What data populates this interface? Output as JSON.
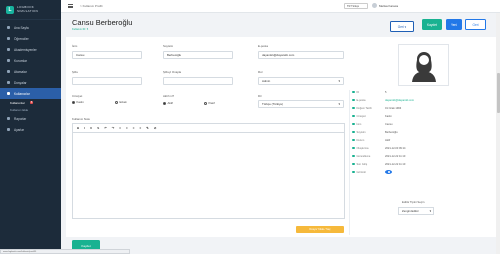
{
  "app": {
    "logo_title": "LOGBOOK",
    "logo_subtitle": "SIMULATION"
  },
  "sidebar": {
    "items": [
      {
        "label": "Ana Sayfa"
      },
      {
        "label": "Öğrenciler"
      },
      {
        "label": "Akademisyenler"
      },
      {
        "label": "Kurumlar"
      },
      {
        "label": "Atamalar"
      },
      {
        "label": "Dosyalar"
      },
      {
        "label": "Kullanıcılar"
      }
    ],
    "sub_items": [
      {
        "label": "Kullanıcılar",
        "badge": "5"
      },
      {
        "label": "Kullanıcı Ekle"
      }
    ],
    "items_after": [
      {
        "label": "Raporlar"
      },
      {
        "label": "Ayarlar"
      }
    ]
  },
  "topbar": {
    "breadcrumb": "> Kullanıcı Profili",
    "language": "TR Türkçe",
    "user_name": "Melisa Karaca"
  },
  "page": {
    "title": "Cansu Berberoğlu",
    "subtitle": "Kullanıcı ID: 5"
  },
  "buttons": {
    "geri": "Geri ▾",
    "kaydet": "Kaydet",
    "yeni": "Yeni",
    "geri2": "Geri",
    "upload": "Dosya Yükle / Seç",
    "save_bottom": "Kaydet"
  },
  "form": {
    "isim_label": "İsim",
    "isim_value": "Cansu",
    "soyisim_label": "Soyisim",
    "soyisim_value": "Berberoğlu",
    "eposta_label": "E-posta",
    "eposta_value": "dayanıklı@dayanıklı.com",
    "sifre_label": "Şifre",
    "sifre_value": "",
    "sifre_tekrar_label": "Şifreyi Onayla",
    "sifre_tekrar_value": "",
    "rol_label": "Rol",
    "rol_value": "Admin",
    "cinsiyet_label": "Cinsiyet",
    "cinsiyet_options": [
      "Kadın",
      "Erkek"
    ],
    "aktif_label": "Aktif mi?",
    "aktif_options": [
      "Aktif",
      "Pasif"
    ],
    "dil_label": "Dil",
    "dil_value": "Türkçe (Türkiye)",
    "notes_label": "Kullanıcı Notu",
    "toolbar_tools": [
      "B",
      "I",
      "U",
      "S",
      "↶",
      "↷",
      "≡",
      "≡",
      "≡",
      "≡",
      "✎",
      "⊘"
    ]
  },
  "info": {
    "rows": [
      {
        "key": "ID",
        "value": "5"
      },
      {
        "key": "E-posta",
        "value": "dayanıklı@dayanıklı.com",
        "link": true
      },
      {
        "key": "Doğum Tarihi",
        "value": "01 Ocak 1993"
      },
      {
        "key": "Cinsiyet",
        "value": "Kadın"
      },
      {
        "key": "İsim",
        "value": "Cansu"
      },
      {
        "key": "Soyisim",
        "value": "Berberoğlu"
      },
      {
        "key": "Durum",
        "value": "Aktif"
      },
      {
        "key": "Oluşturma",
        "value": "2021-12-03 09:14"
      },
      {
        "key": "Güncelleme",
        "value": "2021-12-22 11:10"
      },
      {
        "key": "Son Giriş",
        "value": "2021-12-22 11:10"
      },
      {
        "key": "Görünür",
        "value": ""
      }
    ],
    "edit_type_label": "Editör Tipini Seçin",
    "edit_type_value": "Zengin Editör"
  },
  "statusbar": "www.logbook.com/kullanici/profil/5"
}
